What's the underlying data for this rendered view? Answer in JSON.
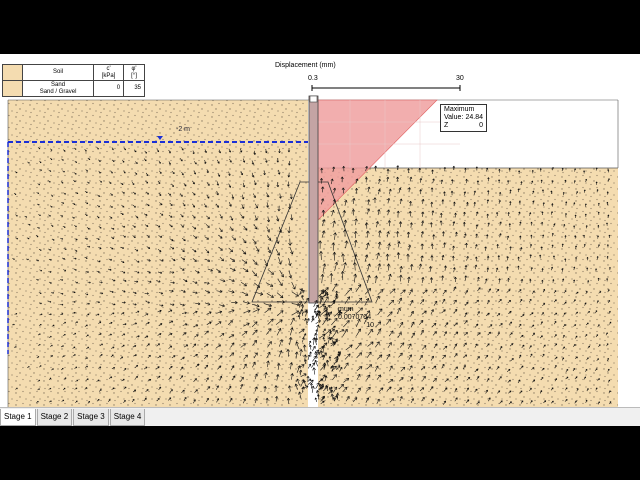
{
  "soil_table": {
    "headers": {
      "soil": "Soil",
      "c": "c'",
      "c_unit": "[kPa]",
      "phi": "φ'",
      "phi_unit": "[°]"
    },
    "row": {
      "name": "Sand",
      "sub": "Sand / Gravel",
      "c": "0",
      "phi": "35"
    }
  },
  "displacement": {
    "title": "Displacement (mm)",
    "min": "0.3",
    "max": "30"
  },
  "maximum": {
    "label": "Maximum",
    "value_label": "Value:",
    "value": "24.84",
    "z_label": "Z",
    "z": "0"
  },
  "minimum": {
    "label": "mum",
    "value_label": "",
    "value": "0.0070704",
    "z": "10"
  },
  "water_level": "-2 m",
  "tabs": [
    {
      "label": "Stage 1"
    },
    {
      "label": "Stage 2"
    },
    {
      "label": "Stage 3"
    },
    {
      "label": "Stage 4"
    }
  ],
  "colors": {
    "soil": "#f4dcb0",
    "envelope": "#f0a0a0",
    "water_line": "#1a2fd6",
    "pile": "#b09090"
  }
}
